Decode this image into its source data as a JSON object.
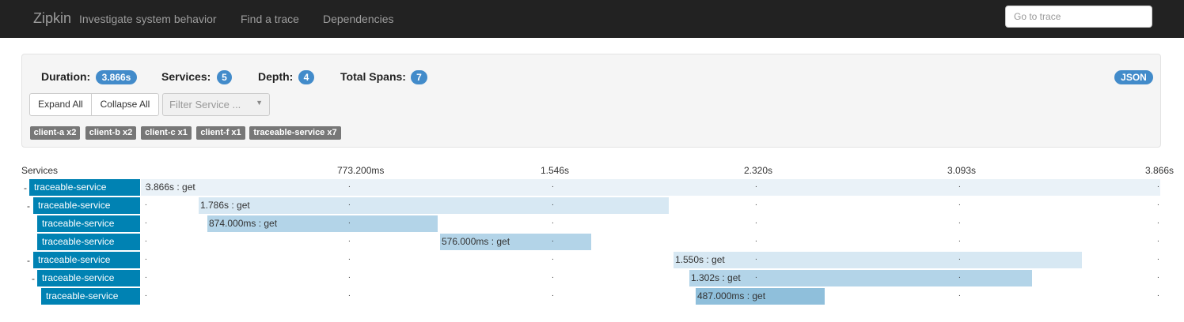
{
  "navbar": {
    "brand": "Zipkin",
    "tagline": "Investigate system behavior",
    "links": [
      "Find a trace",
      "Dependencies"
    ],
    "goto_placeholder": "Go to trace"
  },
  "summary": {
    "duration_label": "Duration:",
    "duration_value": "3.866s",
    "services_label": "Services:",
    "services_value": "5",
    "depth_label": "Depth:",
    "depth_value": "4",
    "total_spans_label": "Total Spans:",
    "total_spans_value": "7",
    "json_button": "JSON",
    "expand_all": "Expand All",
    "collapse_all": "Collapse All",
    "filter_placeholder": "Filter Service ...",
    "service_tags": [
      "client-a x2",
      "client-b x2",
      "client-c x1",
      "client-f x1",
      "traceable-service x7"
    ]
  },
  "timeline": {
    "services_header": "Services",
    "ticks": [
      "773.200ms",
      "1.546s",
      "2.320s",
      "3.093s",
      "3.866s"
    ],
    "rows": [
      {
        "toggle": "-",
        "service": "traceable-service",
        "label": "3.866s : get"
      },
      {
        "toggle": "-",
        "service": "traceable-service",
        "label": "1.786s : get"
      },
      {
        "toggle": "",
        "service": "traceable-service",
        "label": "874.000ms : get"
      },
      {
        "toggle": "",
        "service": "traceable-service",
        "label": "576.000ms : get"
      },
      {
        "toggle": "-",
        "service": "traceable-service",
        "label": "1.550s : get"
      },
      {
        "toggle": "-",
        "service": "traceable-service",
        "label": "1.302s : get"
      },
      {
        "toggle": "",
        "service": "traceable-service",
        "label": "487.000ms : get"
      }
    ]
  },
  "colors": {
    "navbar": "#222222",
    "badge": "#428bca",
    "service_box": "#0082b3",
    "span_level_1": "#eaf2f8",
    "span_level_2": "#d7e8f3",
    "span_level_3": "#b3d4e8",
    "span_level_4": "#8fbfdb"
  }
}
